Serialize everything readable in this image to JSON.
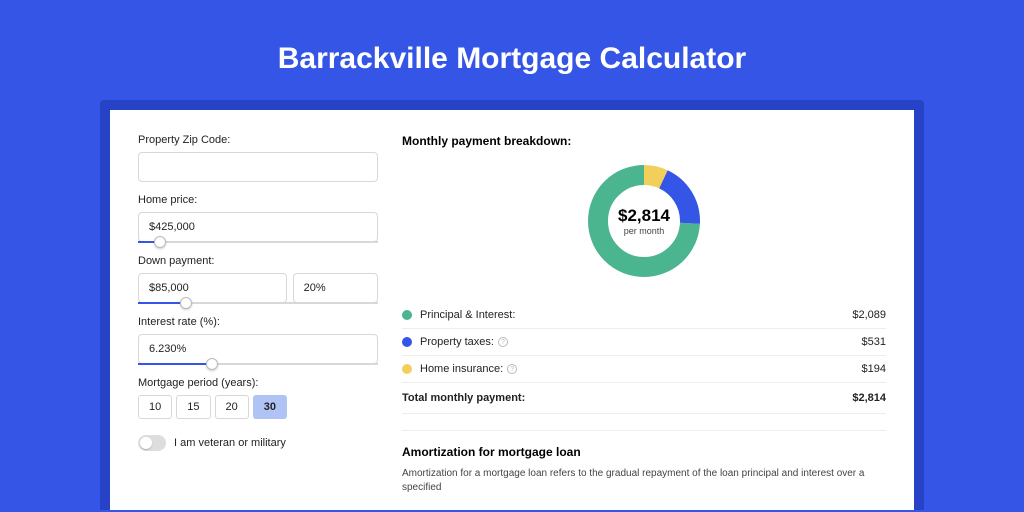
{
  "header": {
    "title": "Barrackville Mortgage Calculator"
  },
  "form": {
    "zip": {
      "label": "Property Zip Code:",
      "value": ""
    },
    "price": {
      "label": "Home price:",
      "value": "$425,000",
      "slider_pct": 9
    },
    "down": {
      "label": "Down payment:",
      "amount": "$85,000",
      "percent": "20%",
      "slider_pct": 20
    },
    "rate": {
      "label": "Interest rate (%):",
      "value": "6.230%",
      "slider_pct": 31
    },
    "period": {
      "label": "Mortgage period (years):",
      "options": [
        "10",
        "15",
        "20",
        "30"
      ],
      "selected": "30"
    },
    "veteran": {
      "label": "I am veteran or military"
    }
  },
  "breakdown": {
    "title": "Monthly payment breakdown:",
    "center_amount": "$2,814",
    "center_sub": "per month",
    "items": [
      {
        "label": "Principal & Interest:",
        "value": "$2,089",
        "color": "#4ab58e",
        "help": false
      },
      {
        "label": "Property taxes:",
        "value": "$531",
        "color": "#3555e6",
        "help": true
      },
      {
        "label": "Home insurance:",
        "value": "$194",
        "color": "#f2cf5b",
        "help": true
      }
    ],
    "total": {
      "label": "Total monthly payment:",
      "value": "$2,814"
    }
  },
  "chart_data": {
    "type": "pie",
    "title": "Monthly payment breakdown",
    "series": [
      {
        "name": "Principal & Interest",
        "value": 2089,
        "color": "#4ab58e"
      },
      {
        "name": "Property taxes",
        "value": 531,
        "color": "#3555e6"
      },
      {
        "name": "Home insurance",
        "value": 194,
        "color": "#f2cf5b"
      }
    ],
    "total": 2814
  },
  "amort": {
    "title": "Amortization for mortgage loan",
    "body": "Amortization for a mortgage loan refers to the gradual repayment of the loan principal and interest over a specified"
  }
}
